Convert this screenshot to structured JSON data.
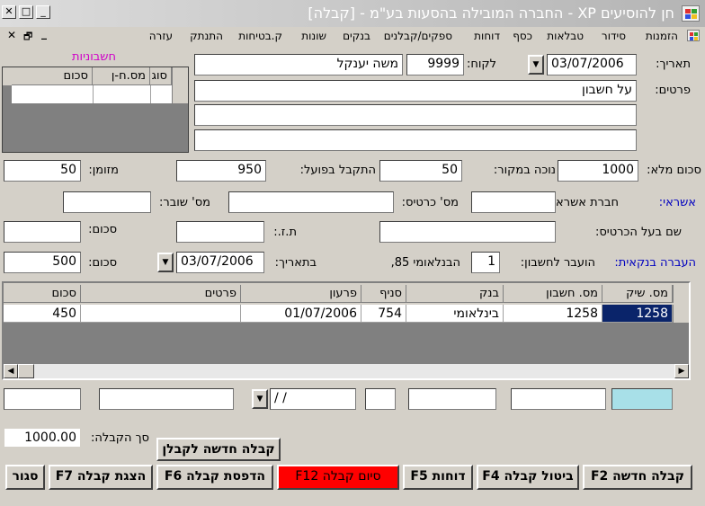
{
  "window": {
    "title": "חן להוסיעים XP - החברה המובילה בהסעות בע\"מ - [קבלה]",
    "menu": [
      "הזמנות",
      "סידור",
      "טבלאות",
      "כסף",
      "דוחות",
      "ספקים/קבלנים",
      "בנקים",
      "שונות",
      "ק.בטיחות",
      "התנתק",
      "עזרה"
    ]
  },
  "header": {
    "date_label": "תאריך:",
    "date_value": "03/07/2006",
    "customer_label": "לקוח:",
    "customer_code": "9999",
    "customer_name": "משה יענקל",
    "details_label": "פרטים:",
    "details_line1": "על חשבון",
    "details_line2": "",
    "details_line3": ""
  },
  "invoices": {
    "title": "חשבוניות",
    "col_type": "סוג",
    "col_number": "מס.ח-ן",
    "col_amount": "סכום"
  },
  "totals": {
    "full_label": "סכום מלא:",
    "full_value": "1000",
    "withholding_label": "נוכה במקור:",
    "withholding_value": "50",
    "actual_label": "התקבל בפועל:",
    "actual_value": "950",
    "cash_label": "מזומן:",
    "cash_value": "50"
  },
  "credit": {
    "section_label": "אשראי:",
    "company_label": "חברת אשראי:",
    "card_no_label": "מס' כרטיס:",
    "voucher_label": "מס' שובר:",
    "holder_label": "שם בעל הכרטיס:",
    "id_label": "ת.ז.:",
    "amount_label": "סכום:"
  },
  "transfer": {
    "section_label": "העברה בנקאית:",
    "to_account_label": "הועבר לחשבון:",
    "account_no": "1",
    "bank_name": "הבנלאומי 85,",
    "date_label": "בתאריך:",
    "date_value": "03/07/2006",
    "amount_label": "סכום:",
    "amount_value": "500"
  },
  "checks": {
    "columns": [
      "מס. שיק",
      "מס. חשבון",
      "בנק",
      "סניף",
      "פרעון",
      "פרטים",
      "סכום"
    ],
    "rows": [
      {
        "check_no": "1258",
        "account": "1258",
        "bank": "בינלאומי",
        "branch": "754",
        "due": "01/07/2006",
        "details": "",
        "amount": "450"
      }
    ],
    "new_row_date": " / /"
  },
  "footer": {
    "receipt_total_label": "סך הקבלה:",
    "receipt_total_value": "1000.00",
    "new_for_contractor": "קבלה חדשה לקבלן",
    "buttons": {
      "new": "קבלה חדשה F2",
      "cancel": "ביטול קבלה F4",
      "reports": "דוחות F5",
      "finish": "סיום קבלה F12",
      "print": "הדפסת קבלה F6",
      "show": "הצגת קבלה F7",
      "close": "סגור"
    }
  },
  "colors": {
    "finish_button": "#ff0000",
    "selected_cell": "#0a246a",
    "new_row_first": "#a8e0e8"
  }
}
